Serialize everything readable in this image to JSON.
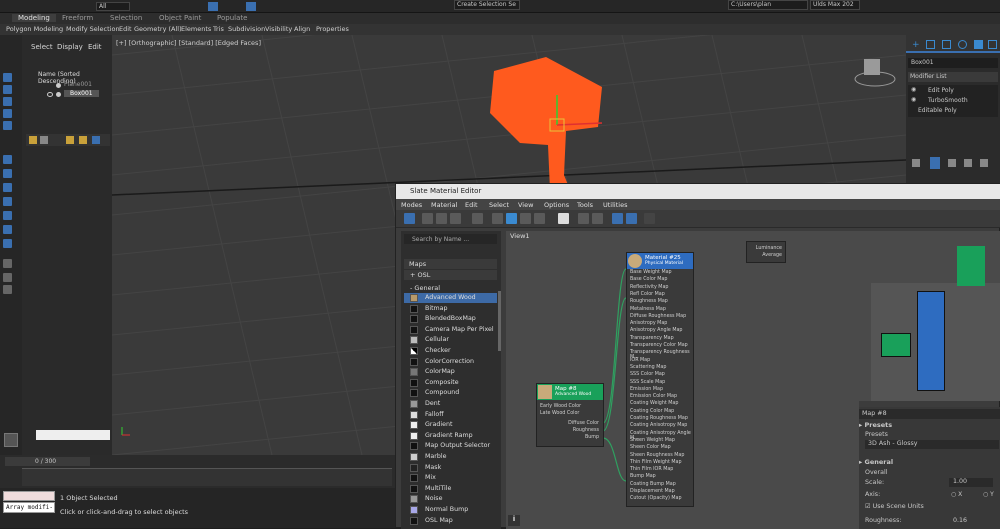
{
  "toolbar": {
    "selection_set": "Create Selection Se",
    "all": "All",
    "path": "C:\\Users\\plan",
    "workspace": "Ulds Max 202"
  },
  "ribbon": {
    "tabs": [
      "Modeling",
      "Freeform",
      "Selection",
      "Object Paint",
      "Populate"
    ],
    "sub": [
      "Polygon Modeling",
      "Modify Selection",
      "Edit",
      "Geometry (All)",
      "Elements",
      "Tris",
      "Subdivision",
      "Visibility",
      "Align",
      "Properties"
    ]
  },
  "scene": {
    "menu": [
      "Select",
      "Display",
      "Edit"
    ],
    "header": "Name (Sorted Descending)",
    "items": [
      "Plane001",
      "Box001"
    ]
  },
  "viewport": {
    "label": "[+] [Orthographic] [Standard] [Edged Faces]"
  },
  "cmd": {
    "object": "Box001",
    "modifier_list": "Modifier List",
    "stack": [
      "Edit Poly",
      "TurboSmooth",
      "Editable Poly"
    ]
  },
  "timeline": {
    "frame": "0 / 300"
  },
  "status": {
    "script": "Array modifi-",
    "selected": "1 Object Selected",
    "hint": "Click or click-and-drag to select objects"
  },
  "slate": {
    "title": "Slate Material Editor",
    "menu": [
      "Modes",
      "Material",
      "Edit",
      "Select",
      "View",
      "Options",
      "Tools",
      "Utilities"
    ],
    "search": "Search by Name ...",
    "maps_header": "Maps",
    "osl": "+ OSL",
    "general": "- General",
    "maps": [
      {
        "name": "Advanced Wood",
        "color": "#b89a6a"
      },
      {
        "name": "Bitmap",
        "color": "#111111"
      },
      {
        "name": "BlendedBoxMap",
        "color": "#111111"
      },
      {
        "name": "Camera Map Per Pixel",
        "color": "#111111"
      },
      {
        "name": "Cellular",
        "color": "#bbbbbb"
      },
      {
        "name": "Checker",
        "color": "#ffffff"
      },
      {
        "name": "ColorCorrection",
        "color": "#111111"
      },
      {
        "name": "ColorMap",
        "color": "#777777"
      },
      {
        "name": "Composite",
        "color": "#111111"
      },
      {
        "name": "Compound",
        "color": "#111111"
      },
      {
        "name": "Dent",
        "color": "#999999"
      },
      {
        "name": "Falloff",
        "color": "#dddddd"
      },
      {
        "name": "Gradient",
        "color": "#eeeeee"
      },
      {
        "name": "Gradient Ramp",
        "color": "#eeeeee"
      },
      {
        "name": "Map Output Selector",
        "color": "#111111"
      },
      {
        "name": "Marble",
        "color": "#cccccc"
      },
      {
        "name": "Mask",
        "color": "#222222"
      },
      {
        "name": "Mix",
        "color": "#111111"
      },
      {
        "name": "MultiTile",
        "color": "#111111"
      },
      {
        "name": "Noise",
        "color": "#999999"
      },
      {
        "name": "Normal Bump",
        "color": "#a8a8e8"
      },
      {
        "name": "OSL Map",
        "color": "#111111"
      }
    ],
    "view_tab": "View1",
    "node_map": {
      "title": "Map #8",
      "sub": "Advanced Wood",
      "slots_in": [
        "Early Wood Color",
        "Late Wood Color"
      ],
      "slots_out": [
        "Diffuse Color",
        "Roughness",
        "Bump"
      ]
    },
    "node_mat": {
      "title": "Material #25",
      "sub": "Physical Material",
      "slots": [
        "Base Weight Map",
        "Base Color Map",
        "Reflectivity Map",
        "Refl Color Map",
        "Roughness Map",
        "Metalness Map",
        "Diffuse Roughness Map",
        "Anisotropy Map",
        "Anisotropy Angle Map",
        "Transparency Map",
        "Transparency Color Map",
        "Transparency Roughness M...",
        "IOR Map",
        "Scattering Map",
        "SSS Color Map",
        "SSS Scale Map",
        "Emission Map",
        "Emission Color Map",
        "Coating Weight Map",
        "Coating Color Map",
        "Coating Roughness Map",
        "Coating Anisotropy Map",
        "Coating Anisotropy Angle M...",
        "Sheen Weight Map",
        "Sheen Color Map",
        "Sheen Roughness Map",
        "Thin Film Weight Map",
        "Thin Film IOR Map",
        "Bump Map",
        "Coating Bump Map",
        "Displacement Map",
        "Cutout (Opacity) Map"
      ]
    },
    "mini_node": [
      "Luminance",
      "Average"
    ],
    "props": {
      "node": "Map #8",
      "presets_header": "Presets",
      "presets_label": "Presets",
      "preset_value": "3D Ash - Glossy",
      "general_header": "General",
      "overall": "Overall",
      "scale_label": "Scale:",
      "scale_value": "1.00",
      "axis_label": "Axis:",
      "axis_x": "X",
      "axis_y": "Y",
      "use_units": "Use Scene Units",
      "roughness_label": "Roughness:",
      "roughness_value": "0.16"
    }
  }
}
